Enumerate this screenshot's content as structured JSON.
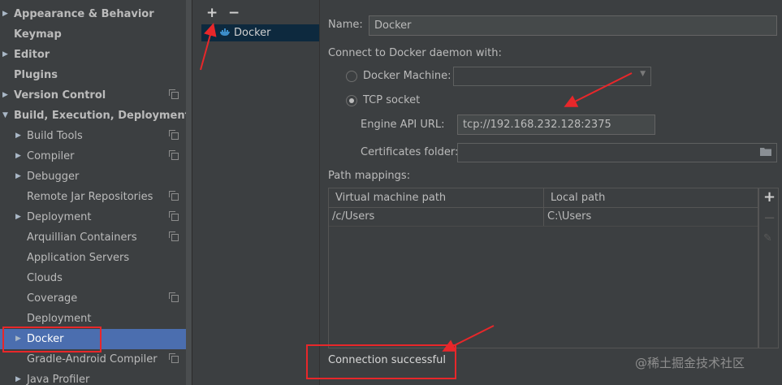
{
  "sidebar": {
    "items": [
      {
        "label": "Appearance & Behavior",
        "bold": true,
        "arrow": "right",
        "indent": 0,
        "copy": false
      },
      {
        "label": "Keymap",
        "bold": true,
        "arrow": "",
        "indent": 0,
        "copy": false
      },
      {
        "label": "Editor",
        "bold": true,
        "arrow": "right",
        "indent": 0,
        "copy": false
      },
      {
        "label": "Plugins",
        "bold": true,
        "arrow": "",
        "indent": 0,
        "copy": false
      },
      {
        "label": "Version Control",
        "bold": true,
        "arrow": "right",
        "indent": 0,
        "copy": true
      },
      {
        "label": "Build, Execution, Deployment",
        "bold": true,
        "arrow": "down",
        "indent": 0,
        "copy": false
      },
      {
        "label": "Build Tools",
        "bold": false,
        "arrow": "right",
        "indent": 1,
        "copy": true
      },
      {
        "label": "Compiler",
        "bold": false,
        "arrow": "right",
        "indent": 1,
        "copy": true
      },
      {
        "label": "Debugger",
        "bold": false,
        "arrow": "right",
        "indent": 1,
        "copy": false
      },
      {
        "label": "Remote Jar Repositories",
        "bold": false,
        "arrow": "",
        "indent": 1,
        "copy": true
      },
      {
        "label": "Deployment",
        "bold": false,
        "arrow": "right",
        "indent": 1,
        "copy": true
      },
      {
        "label": "Arquillian Containers",
        "bold": false,
        "arrow": "",
        "indent": 1,
        "copy": true
      },
      {
        "label": "Application Servers",
        "bold": false,
        "arrow": "",
        "indent": 1,
        "copy": false
      },
      {
        "label": "Clouds",
        "bold": false,
        "arrow": "",
        "indent": 1,
        "copy": false
      },
      {
        "label": "Coverage",
        "bold": false,
        "arrow": "",
        "indent": 1,
        "copy": true
      },
      {
        "label": "Deployment",
        "bold": false,
        "arrow": "",
        "indent": 1,
        "copy": false
      },
      {
        "label": "Docker",
        "bold": false,
        "arrow": "right",
        "indent": 1,
        "copy": false,
        "selected": true
      },
      {
        "label": "Gradle-Android Compiler",
        "bold": false,
        "arrow": "",
        "indent": 1,
        "copy": true
      },
      {
        "label": "Java Profiler",
        "bold": false,
        "arrow": "right",
        "indent": 1,
        "copy": false
      }
    ]
  },
  "toolbar": {
    "add": "+",
    "remove": "−"
  },
  "docker_list": {
    "item_label": "Docker",
    "icon": "docker-whale-icon"
  },
  "form": {
    "name_label": "Name:",
    "name_value": "Docker",
    "connect_label": "Connect to Docker daemon with:",
    "docker_machine_label": "Docker Machine:",
    "docker_machine_value": "",
    "tcp_label": "TCP socket",
    "engine_api_label": "Engine API URL:",
    "engine_api_value": "tcp://192.168.232.128:2375",
    "cert_label": "Certificates folder:",
    "cert_value": "",
    "path_mappings_label": "Path mappings:",
    "selected_connection": "tcp"
  },
  "path_table": {
    "headers": [
      "Virtual machine path",
      "Local path"
    ],
    "rows": [
      [
        "/c/Users",
        "C:\\Users"
      ]
    ],
    "add": "+",
    "remove": "−",
    "edit": "✎"
  },
  "status": {
    "text": "Connection successful"
  },
  "watermark": "@稀土掘金技术社区",
  "colors": {
    "selected": "#4b6eaf",
    "annotation": "#e8272a",
    "background": "#3c3f41"
  }
}
